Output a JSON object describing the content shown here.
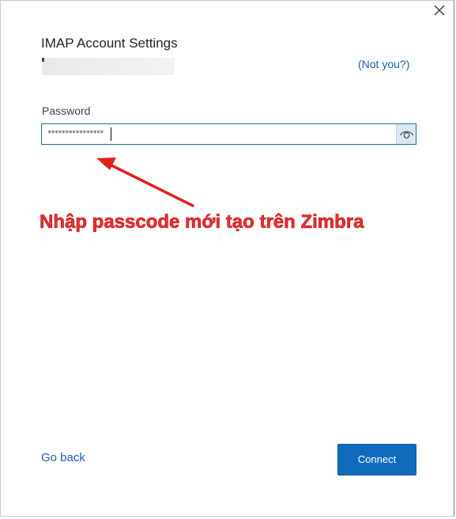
{
  "dialog": {
    "title": "IMAP Account Settings",
    "not_you_label": "(Not you?)",
    "password": {
      "label": "Password",
      "masked_value": "****************"
    },
    "go_back_label": "Go back",
    "connect_label": "Connect"
  },
  "annotation": {
    "text": "Nhập passcode mới tạo trên Zimbra",
    "color": "#ee2d2d"
  },
  "colors": {
    "accent": "#0f6cbd",
    "link": "#1e5aa8",
    "field_border": "#1f6f9a"
  },
  "icons": {
    "close": "close-icon",
    "reveal_password": "eye-icon",
    "annotation_arrow": "arrow-icon"
  }
}
